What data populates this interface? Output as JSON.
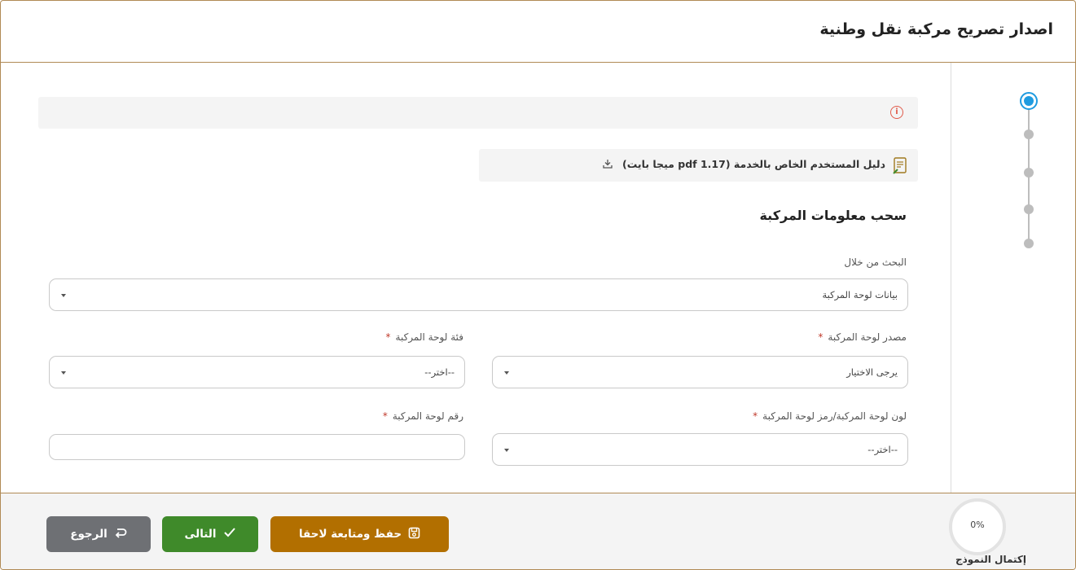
{
  "header": {
    "title": "اصدار تصريح مركبة نقل وطنية"
  },
  "stepper": {
    "steps": 4,
    "active_index": 0,
    "active_color": "#1f9be0"
  },
  "notice": {
    "icon": "info-icon"
  },
  "guide": {
    "icon": "document-icon",
    "label": "دليل المستخدم الخاص بالخدمة (1.17 pdf ميجا بايت)",
    "download_icon": "download-icon"
  },
  "section": {
    "title": "سحب معلومات المركبة"
  },
  "form": {
    "search_by": {
      "label": "البحث من خلال",
      "value": "بيانات لوحة المركبة"
    },
    "plate_source": {
      "label": "مصدر لوحة المركبة",
      "required_mark": "*",
      "value": "يرجى الاختيار"
    },
    "plate_category": {
      "label": "فئة لوحة المركبة",
      "required_mark": "*",
      "value": "--اختر--"
    },
    "plate_color": {
      "label": "لون لوحة المركبة/رمز لوحة المركبة",
      "required_mark": "*",
      "value": "--اختر--"
    },
    "plate_number": {
      "label": "رقم لوحة المركبة",
      "required_mark": "*",
      "value": ""
    }
  },
  "footer": {
    "progress": {
      "value": "0%",
      "label": "إكتمال النموذج",
      "fraction": 0
    },
    "buttons": {
      "save": "حفظ ومتابعة لاحقا",
      "next": "التالى",
      "back": "الرجوع"
    },
    "colors": {
      "save": "#b26f00",
      "next": "#3f8a2a",
      "back": "#6e7074"
    }
  }
}
